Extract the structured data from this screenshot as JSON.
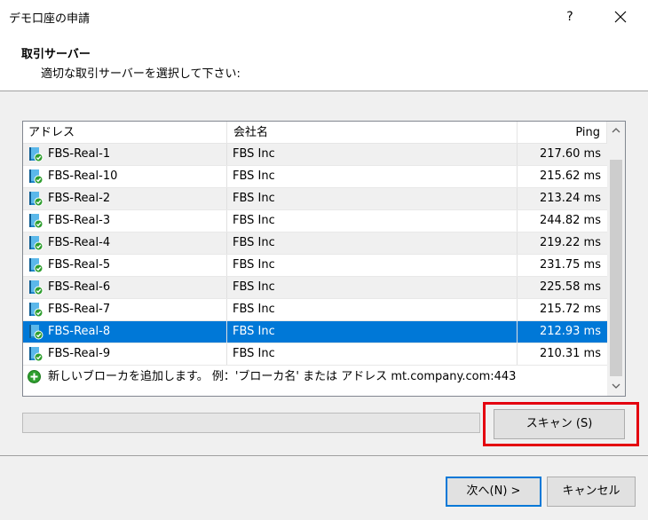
{
  "window": {
    "title": "デモ口座の申請",
    "help_label": "?"
  },
  "header": {
    "title": "取引サーバー",
    "subtitle": "適切な取引サーバーを選択して下さい:"
  },
  "table": {
    "columns": {
      "address": "アドレス",
      "company": "会社名",
      "ping": "Ping"
    },
    "rows": [
      {
        "address": "FBS-Real-1",
        "company": "FBS Inc",
        "ping": "217.60 ms"
      },
      {
        "address": "FBS-Real-10",
        "company": "FBS Inc",
        "ping": "215.62 ms"
      },
      {
        "address": "FBS-Real-2",
        "company": "FBS Inc",
        "ping": "213.24 ms"
      },
      {
        "address": "FBS-Real-3",
        "company": "FBS Inc",
        "ping": "244.82 ms"
      },
      {
        "address": "FBS-Real-4",
        "company": "FBS Inc",
        "ping": "219.22 ms"
      },
      {
        "address": "FBS-Real-5",
        "company": "FBS Inc",
        "ping": "231.75 ms"
      },
      {
        "address": "FBS-Real-6",
        "company": "FBS Inc",
        "ping": "225.58 ms"
      },
      {
        "address": "FBS-Real-7",
        "company": "FBS Inc",
        "ping": "215.72 ms"
      },
      {
        "address": "FBS-Real-8",
        "company": "FBS Inc",
        "ping": "212.93 ms"
      },
      {
        "address": "FBS-Real-9",
        "company": "FBS Inc",
        "ping": "210.31 ms"
      }
    ],
    "selected_row": "FBS-Real-8",
    "add_broker_text": "新しいブローカを追加します。  例：'ブローカ名' または アドレス mt.company.com:443"
  },
  "progress": {
    "value": 0
  },
  "buttons": {
    "scan": "スキャン (S)",
    "next": "次へ(N) >",
    "cancel": "キャンセル"
  },
  "colors": {
    "selection": "#0078d7",
    "highlight_box": "#e4000f",
    "add_icon": "#2e9e2e",
    "server_icon": "#1e88c8"
  },
  "icons": {
    "server": "server-book-icon",
    "add": "plus-circle-icon",
    "close": "close-icon",
    "scroll_up": "chevron-up-icon",
    "scroll_down": "chevron-down-icon"
  }
}
